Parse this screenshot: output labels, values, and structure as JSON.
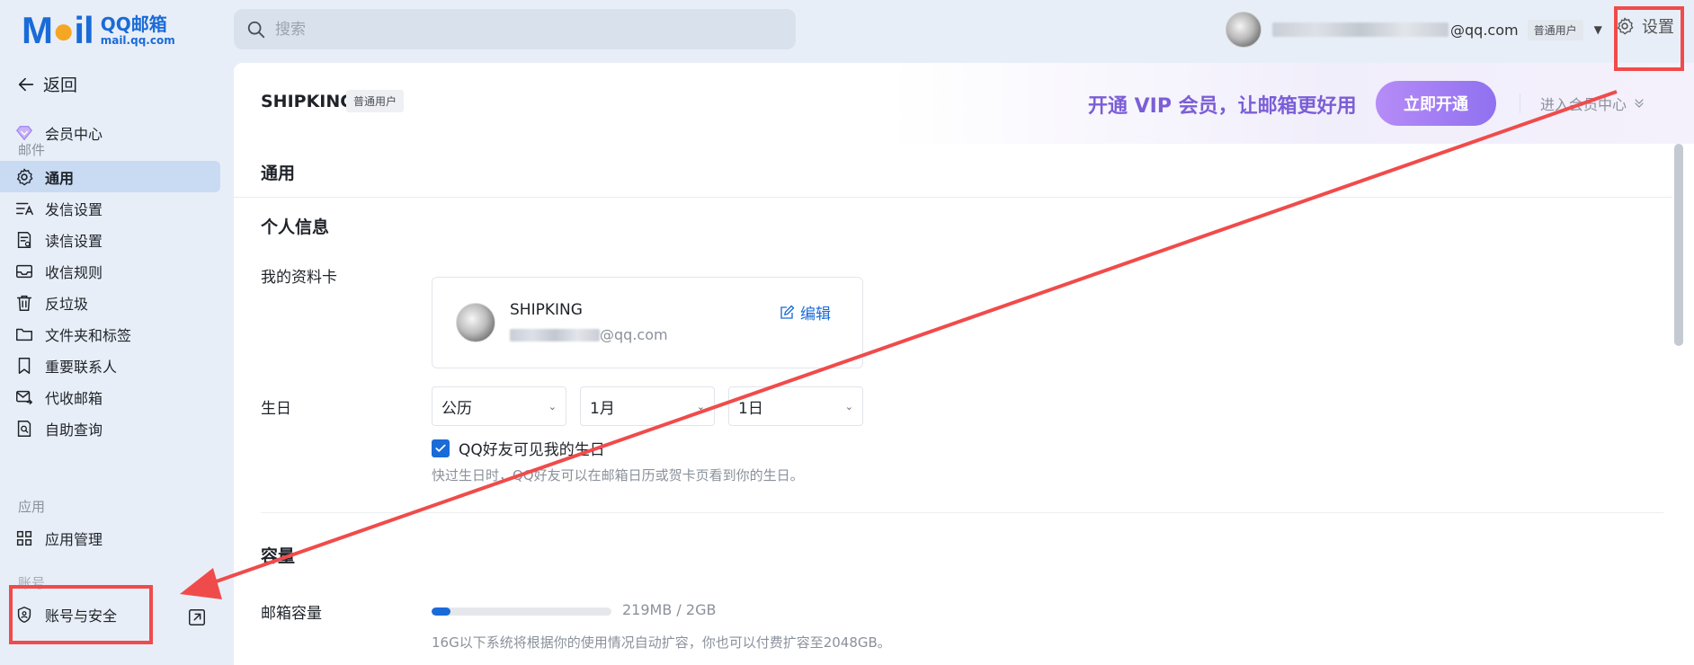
{
  "brand": {
    "logo_text": "Mail",
    "title": "QQ邮箱",
    "sub": "mail.qq.com"
  },
  "search": {
    "placeholder": "搜索"
  },
  "user": {
    "email_suffix": "@qq.com",
    "badge": "普通用户"
  },
  "settings": {
    "label": "设置"
  },
  "sidebar": {
    "back": "返回",
    "vip": "会员中心",
    "sections": {
      "mail": "邮件",
      "apps": "应用",
      "account": "账号"
    },
    "items": [
      {
        "label": "通用",
        "icon": "gear-icon",
        "active": true
      },
      {
        "label": "发信设置",
        "icon": "send-settings-icon"
      },
      {
        "label": "读信设置",
        "icon": "read-settings-icon"
      },
      {
        "label": "收信规则",
        "icon": "inbox-rules-icon"
      },
      {
        "label": "反垃圾",
        "icon": "trash-icon"
      },
      {
        "label": "文件夹和标签",
        "icon": "folder-icon"
      },
      {
        "label": "重要联系人",
        "icon": "bookmark-icon"
      },
      {
        "label": "代收邮箱",
        "icon": "proxy-mail-icon"
      },
      {
        "label": "自助查询",
        "icon": "self-query-icon"
      }
    ],
    "app_items": [
      {
        "label": "应用管理",
        "icon": "apps-grid-icon"
      }
    ],
    "account_items": [
      {
        "label": "账号与安全",
        "icon": "shield-icon"
      }
    ]
  },
  "banner": {
    "account": "SHIPKING",
    "badge": "普通用户",
    "slogan": "开通 VIP 会员，让邮箱更好用",
    "cta": "立即开通",
    "link": "进入会员中心"
  },
  "main": {
    "tab_title": "通用",
    "personal_info": {
      "heading": "个人信息",
      "profile_label": "我的资料卡",
      "card_name": "SHIPKING",
      "card_email_suffix": "@qq.com",
      "edit": "编辑",
      "birthday_label": "生日",
      "calendar": "公历",
      "month": "1月",
      "day": "1日",
      "visibility_check": "QQ好友可见我的生日",
      "visibility_checked": true,
      "visibility_hint": "快过生日时，QQ好友可以在邮箱日历或贺卡页看到你的生日。"
    },
    "capacity": {
      "heading": "容量",
      "label": "邮箱容量",
      "usage": "219MB / 2GB",
      "used_fraction": 0.107,
      "hint": "16G以下系统将根据你的使用情况自动扩容，你也可以付费扩容至2048GB。"
    }
  },
  "colors": {
    "accent": "#1a6bd8",
    "vip": "#7b5ed6",
    "annotation": "#f04b4b"
  }
}
